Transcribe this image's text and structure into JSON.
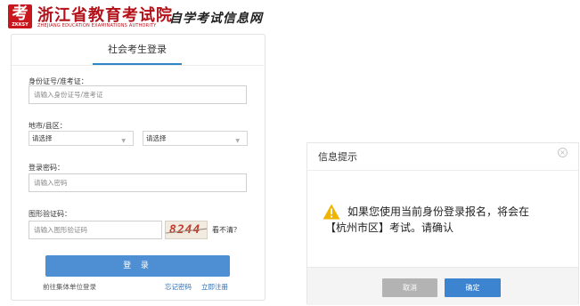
{
  "header": {
    "logo_mark": "考",
    "logo_sub": "ZKKSY",
    "title": "浙江省教育考试院",
    "title_en": "ZHEJIANG EDUCATION EXAMINATIONS AUTHORITY",
    "slogan": "自学考试信息网"
  },
  "login": {
    "tab": "社会考生登录",
    "id_label": "身份证号/准考证：",
    "id_placeholder": "请输入身份证号/准考证",
    "region_label": "地市/县区：",
    "city_value": "请选择",
    "district_value": "请选择",
    "password_label": "登录密码：",
    "password_placeholder": "请输入密码",
    "captcha_label": "图形验证码：",
    "captcha_placeholder": "请输入图形验证码",
    "captcha_text": "8244",
    "refresh_text": "看不清？",
    "login_button": "登 录",
    "group_login_link": "前往集体单位登录",
    "forgot_link": "忘记密码",
    "register_link": "立即注册"
  },
  "dialog": {
    "title": "信息提示",
    "close_icon": "close-icon",
    "message_line1": "如果您使用当前身份登录报名，将会在",
    "message_line2": "【杭州市区】考试。请确认",
    "cancel": "取消",
    "confirm": "确定"
  },
  "colors": {
    "brand_red": "#b3121a",
    "primary_blue": "#4e8fd3",
    "link_blue": "#2f6db0",
    "warning_yellow": "#f0b400"
  }
}
